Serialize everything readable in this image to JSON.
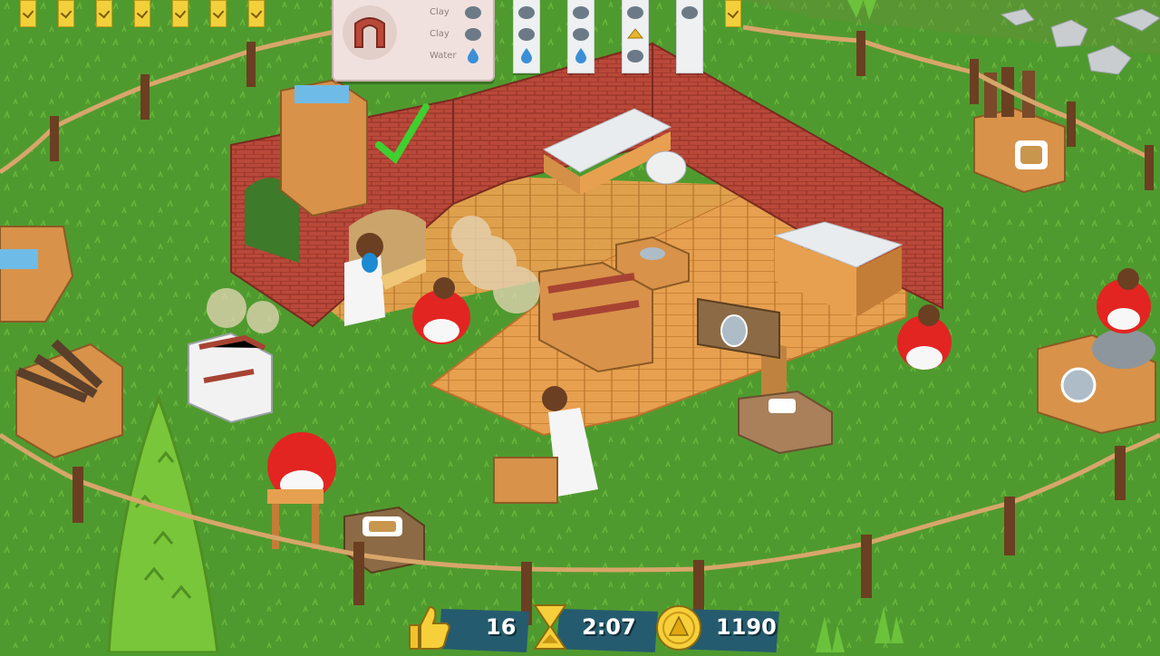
{
  "recipe": {
    "ingredients": [
      {
        "label": "Clay",
        "icon": "clay-icon"
      },
      {
        "label": "Clay",
        "icon": "clay-icon"
      },
      {
        "label": "Water",
        "icon": "water-drop-icon"
      }
    ]
  },
  "orders": [
    {
      "items": [
        "clay-icon",
        "clay-icon",
        "water-drop-icon"
      ]
    },
    {
      "items": [
        "clay-icon",
        "clay-icon",
        "water-drop-icon"
      ]
    },
    {
      "items": [
        "clay-icon",
        "gold-icon",
        "clay-icon"
      ]
    },
    {
      "items": [
        "clay-icon"
      ]
    }
  ],
  "hud": {
    "likes": "16",
    "timer": "2:07",
    "coins": "1190"
  },
  "colors": {
    "grass": "#4f9a2e",
    "brick": "#b9493a",
    "deck": "#e7a04f",
    "hud_panel": "#255b6e",
    "gold": "#f2c22b",
    "worker_red": "#e22521"
  }
}
